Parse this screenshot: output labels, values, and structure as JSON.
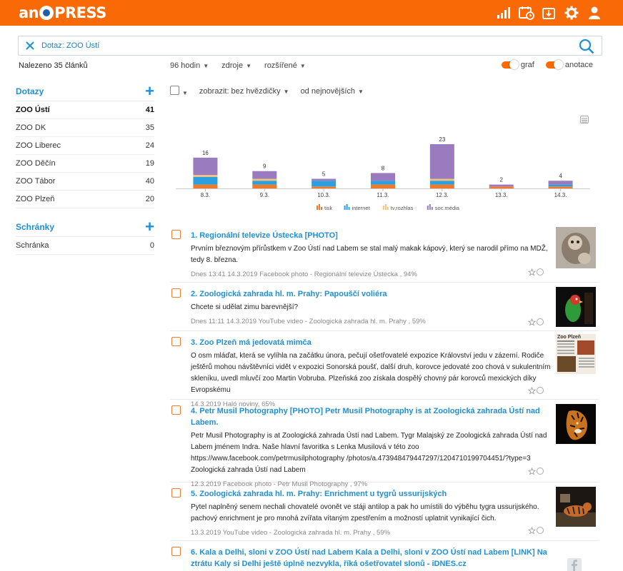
{
  "app": {
    "logo_left": "an",
    "logo_right": "PRESS"
  },
  "search": {
    "query": "Dotaz: ZOO Ústí"
  },
  "results": {
    "found": "Nalezeno 35 článků"
  },
  "filters": {
    "items": [
      {
        "label": "96 hodin"
      },
      {
        "label": "zdroje"
      },
      {
        "label": "rozšířené"
      }
    ]
  },
  "toggles": {
    "graf": "graf",
    "anotace": "anotace"
  },
  "sidebar": {
    "dotazy_title": "Dotazy",
    "dotazy": [
      {
        "label": "ZOO Ústí",
        "count": "41"
      },
      {
        "label": "ZOO DK",
        "count": "35"
      },
      {
        "label": "ZOO Liberec",
        "count": "24"
      },
      {
        "label": "ZOO Děčín",
        "count": "19"
      },
      {
        "label": "ZOO Tábor",
        "count": "40"
      },
      {
        "label": "ZOO Plzeň",
        "count": "20"
      }
    ],
    "schranky_title": "Schránky",
    "schranky": [
      {
        "label": "Schránka",
        "count": "0"
      }
    ]
  },
  "list_tools": {
    "show": "zobrazit: bez hvězdičky",
    "sort": "od nejnovějších"
  },
  "chart_data": {
    "type": "bar",
    "stacked": true,
    "categories": [
      "8.3.",
      "9.3.",
      "10.3.",
      "11.3.",
      "12.3.",
      "13.3.",
      "14.3."
    ],
    "totals": [
      16,
      9,
      5,
      8,
      23,
      2,
      4
    ],
    "series": [
      {
        "name": "tisk",
        "color": "#f07a2a",
        "values": [
          2,
          2,
          1,
          2,
          2,
          1,
          1
        ]
      },
      {
        "name": "internet",
        "color": "#2c9fe0",
        "values": [
          4,
          2,
          3,
          2,
          2,
          0,
          1
        ]
      },
      {
        "name": "tv,rozhlas",
        "color": "#f5c27a",
        "values": [
          1,
          1,
          0,
          0,
          1,
          0,
          0
        ]
      },
      {
        "name": "soc.média",
        "color": "#9b7bbf",
        "values": [
          9,
          4,
          1,
          4,
          18,
          1,
          2
        ]
      }
    ],
    "ylim": [
      0,
      23
    ],
    "legend": "bottom",
    "grid": false
  },
  "articles": [
    {
      "title": "1. Regionální televize Ústecka [PHOTO]",
      "body": "Prvním březnovým přírůstkem v Zoo Ústí nad Labem se stal malý makak kápový, který se narodil přímo na MDŽ, tedy 8. března.",
      "meta": "Dnes 13:41 14.3.2019 Facebook photo - Regionální televize Ústecka , 94%"
    },
    {
      "title": "2. Zoologická zahrada hl. m. Prahy: Papouščí voliéra",
      "body": "Chcete si udělat zimu barevnější?",
      "meta": "Dnes 11:11 14.3.2019 YouTube video - Zoologická zahrada hl. m. Prahy , 59%"
    },
    {
      "title": "3. Zoo Plzeň má jedovatá mimča",
      "body": "O osm mláďat, která se vylíhla na začátku února, pečují ošetřovatelé expozice Království jedu v zázemí. Rodiče ještěrů mohou návštěvníci vidět v expozici Sonorská poušť, další druh, korovce jedovaté zoo chová v sukulentním skleníku, uvedl mluvčí zoo Martin Vobruba. Plzeňská zoo získala dospělý chovný pár korovců mexických díky Evropskému",
      "meta": "14.3.2019 Haló noviny, 65%",
      "thumb_title": "Zoo Plzeň"
    },
    {
      "title": "4. Petr Musil Photography [PHOTO] Petr Musil Photography is at Zoologická zahrada Ústí nad Labem.",
      "body": "Petr Musil Photography is at Zoologická zahrada Ústí nad Labem. Tygr Malajský ze Zoologická zahrada Ústí nad Labem jménem Indra. Naše hlavní favoritka s Lenka Musilová v této zoo https://www.facebook.com/petrmusilphotography /photos/a.473948479447297/1204710199704451/?type=3 Zoologická zahrada Ústí nad Labem",
      "meta": "12.3.2019 Facebook photo - Petr Musil Photography , 97%"
    },
    {
      "title": "5. Zoologická zahrada hl. m. Prahy: Enrichment u tygrů ussurijských",
      "body": "Pytel naplněný senem nechali chovatelé ovonět ve stáji antilop a pak ho umístili do výběhu tygra ussurijského. pachový enrichment je pro mnohá zvířata vítaným zpestřením a možností uplatnit vynikající čich.",
      "meta": "13.3.2019 YouTube video - Zoologická zahrada hl. m. Prahy , 59%"
    },
    {
      "title": "6. Kala a Delhi, sloni v ZOO Ústí nad Labem Kala a Delhi, sloni v ZOO Ústí nad Labem [LINK] Na ztrátu Kaly si Delhi ještě úplně nezvykla, říká ošetřovatel slonů - iDNES.cz",
      "body": "",
      "meta": ""
    }
  ]
}
